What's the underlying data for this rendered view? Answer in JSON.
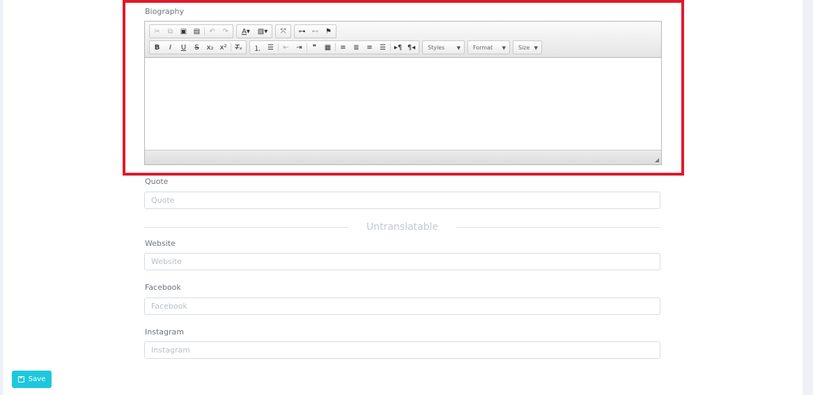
{
  "biography": {
    "label": "Biography",
    "toolbar": {
      "styles_label": "Styles",
      "format_label": "Format",
      "size_label": "Size"
    }
  },
  "quote": {
    "label": "Quote",
    "placeholder": "Quote"
  },
  "section_divider": {
    "label": "Untranslatable"
  },
  "website": {
    "label": "Website",
    "placeholder": "Website"
  },
  "facebook": {
    "label": "Facebook",
    "placeholder": "Facebook"
  },
  "instagram": {
    "label": "Instagram",
    "placeholder": "Instagram"
  },
  "actions": {
    "save_label": "Save"
  },
  "colors": {
    "highlight": "#e0192c",
    "save_button": "#1ec8dc"
  }
}
